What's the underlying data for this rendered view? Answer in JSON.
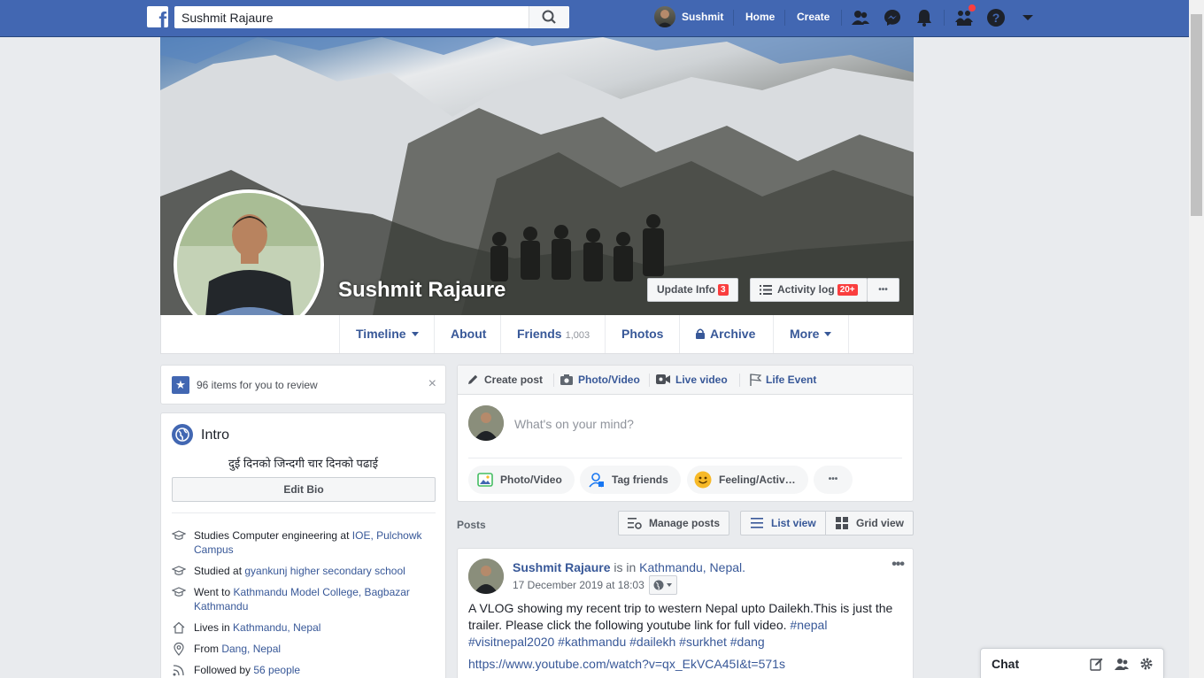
{
  "topbar": {
    "logo_letter": "f",
    "search_value": "Sushmit Rajaure",
    "user_name": "Sushmit",
    "home_label": "Home",
    "create_label": "Create",
    "accent": "#4267b2"
  },
  "profile": {
    "name": "Sushmit Rajaure",
    "update_info_label": "Update Info",
    "update_info_badge": "3",
    "activity_log_label": "Activity log",
    "activity_log_badge": "20+",
    "more_label": "•••"
  },
  "tabs": {
    "timeline": "Timeline",
    "about": "About",
    "friends": "Friends",
    "friends_count": "1,003",
    "photos": "Photos",
    "archive": "Archive",
    "more": "More"
  },
  "review": {
    "text": "96 items for you to review",
    "close": "×"
  },
  "intro": {
    "title": "Intro",
    "bio": "दुई दिनको जिन्दगी चार दिनको पढाई",
    "edit_bio_label": "Edit Bio",
    "items": [
      {
        "prefix": "Studies Computer engineering at ",
        "link": "IOE, Pulchowk Campus",
        "icon": "graduation-cap-icon"
      },
      {
        "prefix": "Studied at ",
        "link": "gyankunj higher secondary school",
        "icon": "graduation-cap-icon"
      },
      {
        "prefix": "Went to ",
        "link": "Kathmandu Model College, Bagbazar Kathmandu",
        "icon": "graduation-cap-icon"
      },
      {
        "prefix": "Lives in ",
        "link": "Kathmandu, Nepal",
        "icon": "home-icon"
      },
      {
        "prefix": "From ",
        "link": "Dang, Nepal",
        "icon": "location-pin-icon"
      },
      {
        "prefix": "Followed by ",
        "link": "56 people",
        "icon": "rss-icon"
      }
    ]
  },
  "composer": {
    "tabs": [
      "Create post",
      "Photo/Video",
      "Live video",
      "Life Event"
    ],
    "placeholder": "What's on your mind?",
    "pills": [
      "Photo/Video",
      "Tag friends",
      "Feeling/Activ…"
    ],
    "more_label": "•••"
  },
  "posts": {
    "label": "Posts",
    "manage_label": "Manage posts",
    "list_view_label": "List view",
    "grid_view_label": "Grid view"
  },
  "post": {
    "author": "Sushmit Rajaure",
    "is_in": " is in ",
    "location": "Kathmandu, Nepal.",
    "time": "17 December 2019 at 18:03",
    "body": "A VLOG showing my recent trip to western Nepal upto Dailekh.This is just the trailer. Please click the following youtube link for full video. ",
    "hashtags": "#nepal #visitnepal2020 #kathmandu #dailekh #surkhet #dang",
    "link": "https://www.youtube.com/watch?v=qx_EkVCA45I&t=571s",
    "more_label": "•••"
  },
  "chat": {
    "label": "Chat"
  }
}
